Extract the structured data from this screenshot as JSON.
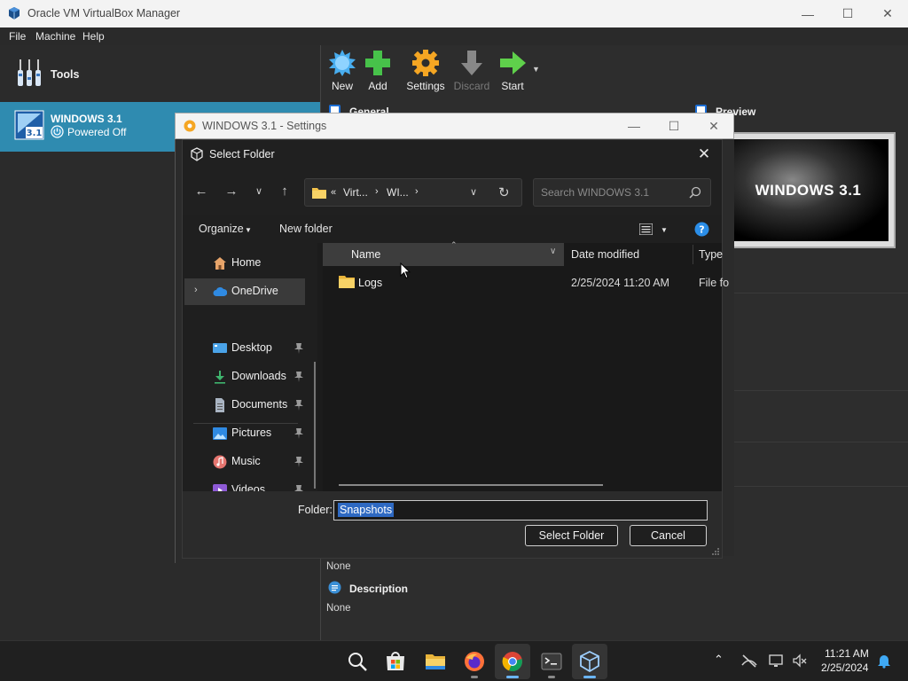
{
  "vbox": {
    "title": "Oracle VM VirtualBox Manager",
    "menu": [
      "File",
      "Machine",
      "Help"
    ],
    "tools_label": "Tools",
    "vm": {
      "name": "WINDOWS 3.1",
      "state": "Powered Off",
      "badge": "3.1"
    },
    "toolbar": {
      "new": "New",
      "add": "Add",
      "settings": "Settings",
      "discard": "Discard",
      "start": "Start"
    },
    "sections": {
      "general": "General",
      "preview": "Preview",
      "description": "Description"
    },
    "preview_text": "WINDOWS 3.1",
    "details": {
      "shared_none": "None",
      "description_value": "None"
    }
  },
  "settings": {
    "title": "WINDOWS 3.1 - Settings"
  },
  "dialog": {
    "title": "Select Folder",
    "breadcrumb": {
      "prefix": "«",
      "item1": "Virt...",
      "item2": "WI..."
    },
    "search_placeholder": "Search WINDOWS 3.1",
    "commands": {
      "organize": "Organize",
      "new_folder": "New folder"
    },
    "nav": {
      "home": "Home",
      "onedrive": "OneDrive",
      "desktop": "Desktop",
      "downloads": "Downloads",
      "documents": "Documents",
      "pictures": "Pictures",
      "music": "Music",
      "videos": "Videos"
    },
    "columns": {
      "name": "Name",
      "date": "Date modified",
      "type": "Type"
    },
    "files": [
      {
        "name": "Logs",
        "date": "2/25/2024 11:20 AM",
        "type": "File fo"
      }
    ],
    "folder_label": "Folder:",
    "folder_value": "Snapshots",
    "select_button": "Select Folder",
    "cancel_button": "Cancel"
  },
  "taskbar": {
    "time": "11:21 AM",
    "date": "2/25/2024"
  },
  "colors": {
    "accent": "#2f8bb0",
    "selection": "#2e69c2",
    "taskbar": "#202020"
  }
}
